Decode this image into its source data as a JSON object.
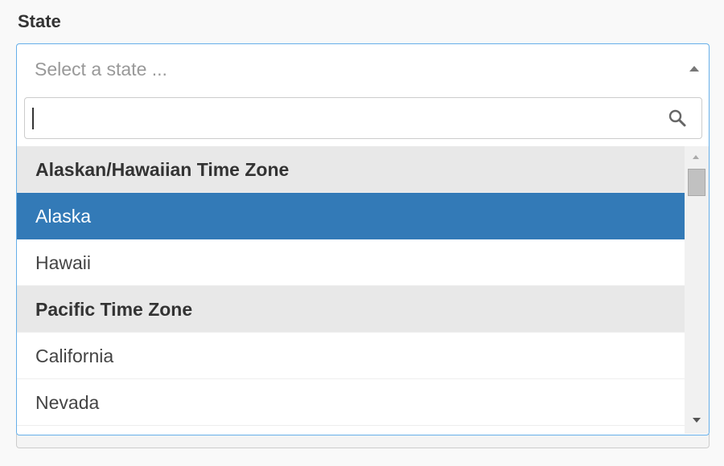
{
  "field": {
    "label": "State",
    "placeholder": "Select a state ...",
    "search_value": ""
  },
  "options": [
    {
      "label": "Alaskan/Hawaiian Time Zone",
      "type": "group"
    },
    {
      "label": "Alaska",
      "type": "option",
      "selected": true
    },
    {
      "label": "Hawaii",
      "type": "option"
    },
    {
      "label": "Pacific Time Zone",
      "type": "group"
    },
    {
      "label": "California",
      "type": "option"
    },
    {
      "label": "Nevada",
      "type": "option"
    }
  ],
  "icons": {
    "search": "search-icon",
    "select_arrow": "caret-up-icon"
  },
  "colors": {
    "selected_bg": "#337ab7",
    "focus_border": "#66afe9",
    "group_bg": "#e8e8e8",
    "placeholder": "#999999"
  }
}
